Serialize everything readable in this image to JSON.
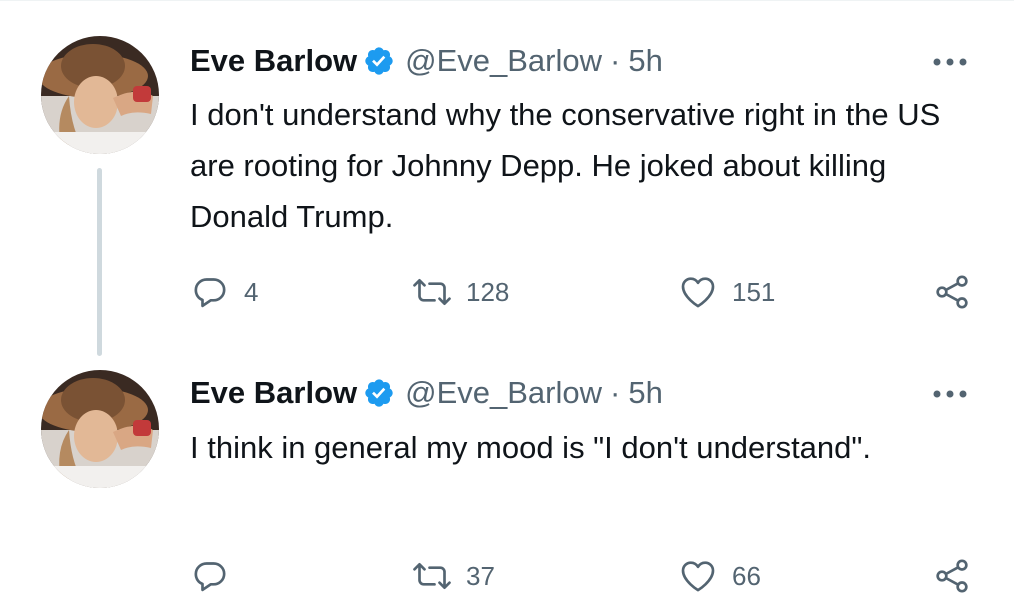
{
  "thread": {
    "tweets": [
      {
        "author_name": "Eve Barlow",
        "handle": "@Eve_Barlow",
        "separator": "·",
        "time": "5h",
        "text": "I don't understand why the conservative right in the US are rooting for Johnny Depp. He joked about killing Donald Trump.",
        "replies": "4",
        "retweets": "128",
        "likes": "151"
      },
      {
        "author_name": "Eve Barlow",
        "handle": "@Eve_Barlow",
        "separator": "·",
        "time": "5h",
        "text": "I think in general my mood is \"I don't understand\".",
        "replies": "",
        "retweets": "37",
        "likes": "66"
      }
    ]
  },
  "colors": {
    "primary_text": "#0f1419",
    "secondary_text": "#536471",
    "verified_badge": "#1d9bf0",
    "thread_line": "#cfd9de"
  },
  "icons": {
    "verified": "verified-badge-icon",
    "more": "more-horizontal-icon",
    "reply": "reply-icon",
    "retweet": "retweet-icon",
    "like": "heart-icon",
    "share": "share-icon"
  }
}
